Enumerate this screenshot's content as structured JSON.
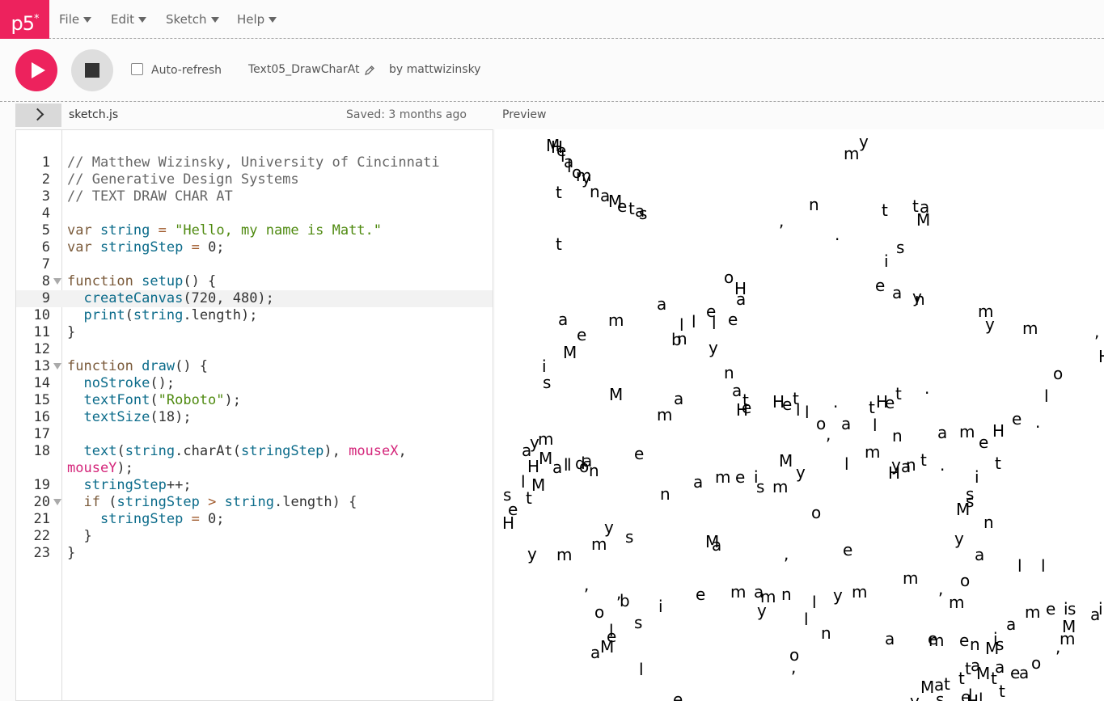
{
  "app": {
    "logo": "p5",
    "logo_mark": "*"
  },
  "menu": {
    "file": "File",
    "edit": "Edit",
    "sketch": "Sketch",
    "help": "Help"
  },
  "toolbar": {
    "autorefresh_label": "Auto-refresh",
    "autorefresh_checked": false,
    "project_name": "Text05_DrawCharAt",
    "byline": "by mattwizinsky"
  },
  "editor": {
    "filename": "sketch.js",
    "saved": "Saved: 3 months ago",
    "active_line": 9,
    "lines": [
      {
        "n": "1",
        "html": "<span class='c'>// Matthew Wizinsky, University of Cincinnati</span>"
      },
      {
        "n": "2",
        "html": "<span class='c'>// Generative Design Systems</span>"
      },
      {
        "n": "3",
        "html": "<span class='c'>// TEXT DRAW CHAR AT</span>"
      },
      {
        "n": "4",
        "html": ""
      },
      {
        "n": "5",
        "html": "<span class='k'>var</span> <span class='v'>string</span> <span class='o'>=</span> <span class='s'>\"Hello, my name is Matt.\"</span>"
      },
      {
        "n": "6",
        "html": "<span class='k'>var</span> <span class='v'>stringStep</span> <span class='o'>=</span> 0;"
      },
      {
        "n": "7",
        "html": ""
      },
      {
        "n": "8",
        "fold": true,
        "html": "<span class='k'>function</span> <span class='f'>setup</span>() {"
      },
      {
        "n": "9",
        "html": "  <span class='f'>createCanvas</span>(720, 480);"
      },
      {
        "n": "10",
        "html": "  <span class='f'>print</span>(<span class='v'>string</span>.length);"
      },
      {
        "n": "11",
        "html": "}"
      },
      {
        "n": "12",
        "html": ""
      },
      {
        "n": "13",
        "fold": true,
        "html": "<span class='k'>function</span> <span class='f'>draw</span>() {"
      },
      {
        "n": "14",
        "html": "  <span class='f'>noStroke</span>();"
      },
      {
        "n": "15",
        "html": "  <span class='f'>textFont</span>(<span class='s'>\"Roboto\"</span>);"
      },
      {
        "n": "16",
        "html": "  <span class='f'>textSize</span>(18);"
      },
      {
        "n": "17",
        "html": ""
      },
      {
        "n": "18",
        "html": "  <span class='f'>text</span>(<span class='v'>string</span>.charAt(<span class='v'>stringStep</span>), <span class='p'>mouseX</span>,"
      },
      {
        "n": "",
        "html": "<span class='p'>mouseY</span>);"
      },
      {
        "n": "19",
        "html": "  <span class='v'>stringStep</span>++;"
      },
      {
        "n": "20",
        "fold": true,
        "html": "  <span class='k'>if</span> (<span class='v'>stringStep</span> <span class='o'>&gt;</span> <span class='v'>string</span>.length) {"
      },
      {
        "n": "21",
        "html": "    <span class='v'>stringStep</span> <span class='o'>=</span> 0;"
      },
      {
        "n": "22",
        "html": "  }"
      },
      {
        "n": "23",
        "html": "}"
      }
    ]
  },
  "preview": {
    "label": "Preview",
    "glyphs": [
      [
        "M",
        675,
        170
      ],
      [
        "H",
        681,
        172
      ],
      [
        "e",
        688,
        176
      ],
      [
        "l",
        693,
        183
      ],
      [
        "a",
        697,
        190
      ],
      [
        "l",
        701,
        196
      ],
      [
        "o",
        707,
        203
      ],
      [
        "m",
        712,
        207
      ],
      [
        "y",
        719,
        210
      ],
      [
        "n",
        729,
        227
      ],
      [
        "a",
        742,
        232
      ],
      [
        "M",
        752,
        239
      ],
      [
        "e",
        763,
        245
      ],
      [
        "t",
        777,
        248
      ],
      [
        "a",
        785,
        251
      ],
      [
        "s",
        790,
        254
      ],
      [
        "t",
        687,
        228
      ],
      [
        "m",
        1043,
        180
      ],
      [
        "y",
        1062,
        165
      ],
      [
        "n",
        1000,
        243
      ],
      [
        ",",
        963,
        263
      ],
      [
        "t",
        1090,
        250
      ],
      [
        "t",
        1128,
        245
      ],
      [
        "a",
        1137,
        246
      ],
      [
        "M",
        1133,
        262
      ],
      [
        ".",
        1032,
        280
      ],
      [
        "t",
        687,
        292
      ],
      [
        "s",
        1108,
        296
      ],
      [
        "i",
        1093,
        313
      ],
      [
        "o",
        895,
        333
      ],
      [
        "H",
        908,
        347
      ],
      [
        "a",
        910,
        360
      ],
      [
        "e",
        1082,
        343
      ],
      [
        "a",
        1103,
        352
      ],
      [
        "y",
        1128,
        357
      ],
      [
        "n",
        1131,
        360
      ],
      [
        "a",
        690,
        385
      ],
      [
        "m",
        752,
        386
      ],
      [
        "a",
        812,
        366
      ],
      [
        "l",
        840,
        392
      ],
      [
        "e",
        873,
        375
      ],
      [
        "l",
        855,
        388
      ],
      [
        "l",
        880,
        390
      ],
      [
        "e",
        900,
        385
      ],
      [
        "b",
        830,
        410
      ],
      [
        "n",
        837,
        409
      ],
      [
        "y",
        876,
        420
      ],
      [
        "e",
        713,
        404
      ],
      [
        "m",
        1209,
        375
      ],
      [
        "y",
        1218,
        391
      ],
      [
        "m",
        1264,
        396
      ],
      [
        ",",
        1353,
        400
      ],
      [
        "M",
        696,
        426
      ],
      [
        "i",
        670,
        443
      ],
      [
        "s",
        671,
        463
      ],
      [
        "n",
        895,
        451
      ],
      [
        "a",
        905,
        473
      ],
      [
        "a",
        833,
        483
      ],
      [
        "M",
        753,
        478
      ],
      [
        "m",
        812,
        503
      ],
      [
        "t",
        918,
        485
      ],
      [
        "H",
        910,
        497
      ],
      [
        "e",
        917,
        494
      ],
      [
        "H",
        955,
        487
      ],
      [
        "e",
        967,
        490
      ],
      [
        "t",
        980,
        483
      ],
      [
        "l",
        984,
        497
      ],
      [
        "l",
        995,
        500
      ],
      [
        "o",
        1009,
        514
      ],
      [
        ",",
        1021,
        527
      ],
      [
        "a",
        1040,
        514
      ],
      [
        "l",
        1079,
        516
      ],
      [
        "n",
        1103,
        529
      ],
      [
        "t",
        1074,
        494
      ],
      [
        "H",
        1083,
        487
      ],
      [
        "e",
        1094,
        488
      ],
      [
        "t",
        1107,
        477
      ],
      [
        ".",
        1030,
        487
      ],
      [
        ".",
        1143,
        470
      ],
      [
        "l",
        1291,
        480
      ],
      [
        "o",
        1302,
        452
      ],
      [
        "a",
        1159,
        525
      ],
      [
        "m",
        1186,
        524
      ],
      [
        "e",
        1210,
        537
      ],
      [
        "H",
        1227,
        523
      ],
      [
        "e",
        1251,
        508
      ],
      [
        ".",
        1280,
        512
      ],
      [
        "H",
        1358,
        431
      ],
      [
        "a",
        645,
        547
      ],
      [
        "y",
        655,
        537
      ],
      [
        "m",
        665,
        533
      ],
      [
        "H",
        652,
        567
      ],
      [
        "M",
        666,
        557
      ],
      [
        "a",
        683,
        568
      ],
      [
        "l",
        697,
        565
      ],
      [
        "l",
        701,
        565
      ],
      [
        "d",
        711,
        563
      ],
      [
        "a",
        720,
        560
      ],
      [
        "o",
        716,
        567
      ],
      [
        "n",
        728,
        572
      ],
      [
        "e",
        784,
        551
      ],
      [
        "l",
        644,
        586
      ],
      [
        "M",
        657,
        590
      ],
      [
        "s",
        622,
        602
      ],
      [
        "t",
        650,
        606
      ],
      [
        "e",
        628,
        620
      ],
      [
        "H",
        621,
        637
      ],
      [
        "a",
        857,
        586
      ],
      [
        "m",
        884,
        580
      ],
      [
        "e",
        909,
        580
      ],
      [
        "i",
        932,
        580
      ],
      [
        "s",
        935,
        592
      ],
      [
        "m",
        955,
        592
      ],
      [
        "M",
        963,
        560
      ],
      [
        "y",
        984,
        574
      ],
      [
        "l",
        1044,
        564
      ],
      [
        "m",
        1069,
        549
      ],
      [
        "y",
        1102,
        565
      ],
      [
        "H",
        1098,
        575
      ],
      [
        "a",
        1114,
        567
      ],
      [
        "n",
        1120,
        565
      ],
      [
        "t",
        1138,
        559
      ],
      [
        ".",
        1162,
        565
      ],
      [
        "i",
        1205,
        580
      ],
      [
        "t",
        1230,
        563
      ],
      [
        "n",
        816,
        601
      ],
      [
        "o",
        1003,
        624
      ],
      [
        "s",
        1194,
        601
      ],
      [
        "s",
        1194,
        610
      ],
      [
        "M",
        1182,
        620
      ],
      [
        "n",
        1216,
        636
      ],
      [
        "y",
        747,
        642
      ],
      [
        "s",
        773,
        654
      ],
      [
        "m",
        731,
        663
      ],
      [
        "y",
        652,
        675
      ],
      [
        "m",
        688,
        676
      ],
      [
        "M",
        872,
        660
      ],
      [
        "a",
        880,
        664
      ],
      [
        ",",
        969,
        675
      ],
      [
        "e",
        1042,
        670
      ],
      [
        "y",
        1180,
        656
      ],
      [
        "a",
        1205,
        676
      ],
      [
        ",",
        722,
        713
      ],
      [
        ",",
        762,
        723
      ],
      [
        "b",
        766,
        733
      ],
      [
        "i",
        814,
        740
      ],
      [
        "e",
        860,
        725
      ],
      [
        "m",
        903,
        722
      ],
      [
        "a",
        932,
        722
      ],
      [
        "m",
        940,
        728
      ],
      [
        "n",
        966,
        725
      ],
      [
        "y",
        936,
        745
      ],
      [
        "l",
        1004,
        735
      ],
      [
        "l",
        994,
        756
      ],
      [
        "y",
        1030,
        726
      ],
      [
        "m",
        1053,
        722
      ],
      [
        "m",
        1116,
        705
      ],
      [
        "o",
        1187,
        708
      ],
      [
        ",",
        1160,
        718
      ],
      [
        "m",
        1173,
        735
      ],
      [
        "l",
        1258,
        690
      ],
      [
        "l",
        1287,
        690
      ],
      [
        "o",
        735,
        747
      ],
      [
        "s",
        784,
        760
      ],
      [
        "e",
        750,
        777
      ],
      [
        "l",
        753,
        770
      ],
      [
        "M",
        742,
        790
      ],
      [
        "a",
        730,
        797
      ],
      [
        "l",
        790,
        818
      ],
      [
        "n",
        1015,
        773
      ],
      [
        "a",
        1094,
        780
      ],
      [
        "e",
        1147,
        780
      ],
      [
        "m",
        1148,
        782
      ],
      [
        "e",
        1186,
        782
      ],
      [
        "n",
        1199,
        787
      ],
      [
        "i",
        1228,
        780
      ],
      [
        "s",
        1231,
        787
      ],
      [
        "M",
        1218,
        792
      ],
      [
        "a",
        1244,
        762
      ],
      [
        "m",
        1267,
        747
      ],
      [
        "e",
        1293,
        743
      ],
      [
        "i",
        1315,
        743
      ],
      [
        "s",
        1320,
        743
      ],
      [
        "M",
        1313,
        765
      ],
      [
        "a",
        1348,
        750
      ],
      [
        "i",
        1358,
        743
      ],
      [
        ",",
        1305,
        790
      ],
      [
        "m",
        1310,
        780
      ],
      [
        "o",
        976,
        800
      ],
      [
        ",",
        978,
        815
      ],
      [
        "t",
        1193,
        817
      ],
      [
        "a",
        1200,
        813
      ],
      [
        "M",
        1207,
        823
      ],
      [
        "t",
        1225,
        829
      ],
      [
        "a",
        1230,
        815
      ],
      [
        "e",
        1249,
        822
      ],
      [
        "a",
        1260,
        822
      ],
      [
        "o",
        1275,
        810
      ],
      [
        "M",
        1138,
        840
      ],
      [
        "a",
        1155,
        837
      ],
      [
        "t",
        1167,
        836
      ],
      [
        "t",
        1185,
        829
      ],
      [
        "l",
        1197,
        850
      ],
      [
        "t",
        1235,
        845
      ],
      [
        "e",
        1188,
        852
      ],
      [
        "H",
        1195,
        857
      ],
      [
        "l",
        1210,
        855
      ],
      [
        "y",
        1125,
        857
      ],
      [
        "s",
        1157,
        855
      ],
      [
        "e",
        832,
        855
      ]
    ]
  }
}
